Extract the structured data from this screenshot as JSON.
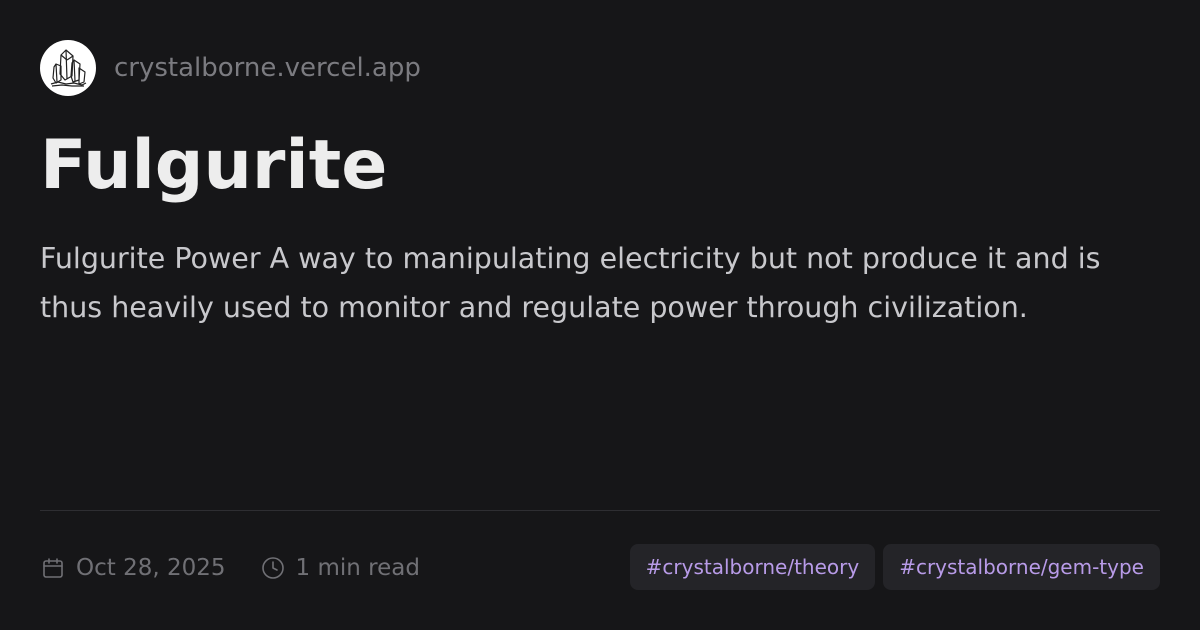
{
  "site": {
    "name": "crystalborne.vercel.app",
    "logo_icon": "crystal-cluster-icon"
  },
  "post": {
    "title": "Fulgurite",
    "description": "Fulgurite Power A way to manipulating electricity but not produce it and is thus heavily used to monitor and regulate power through civilization."
  },
  "meta": {
    "date": "Oct 28, 2025",
    "date_icon": "calendar-icon",
    "read_time": "1 min read",
    "read_time_icon": "clock-icon"
  },
  "tags": [
    "#crystalborne/theory",
    "#crystalborne/gem-type"
  ],
  "colors": {
    "background": "#161618",
    "title": "#ededed",
    "description": "#c8c8cc",
    "muted": "#707075",
    "tag_background": "#242428",
    "tag_text": "#b89be8"
  }
}
